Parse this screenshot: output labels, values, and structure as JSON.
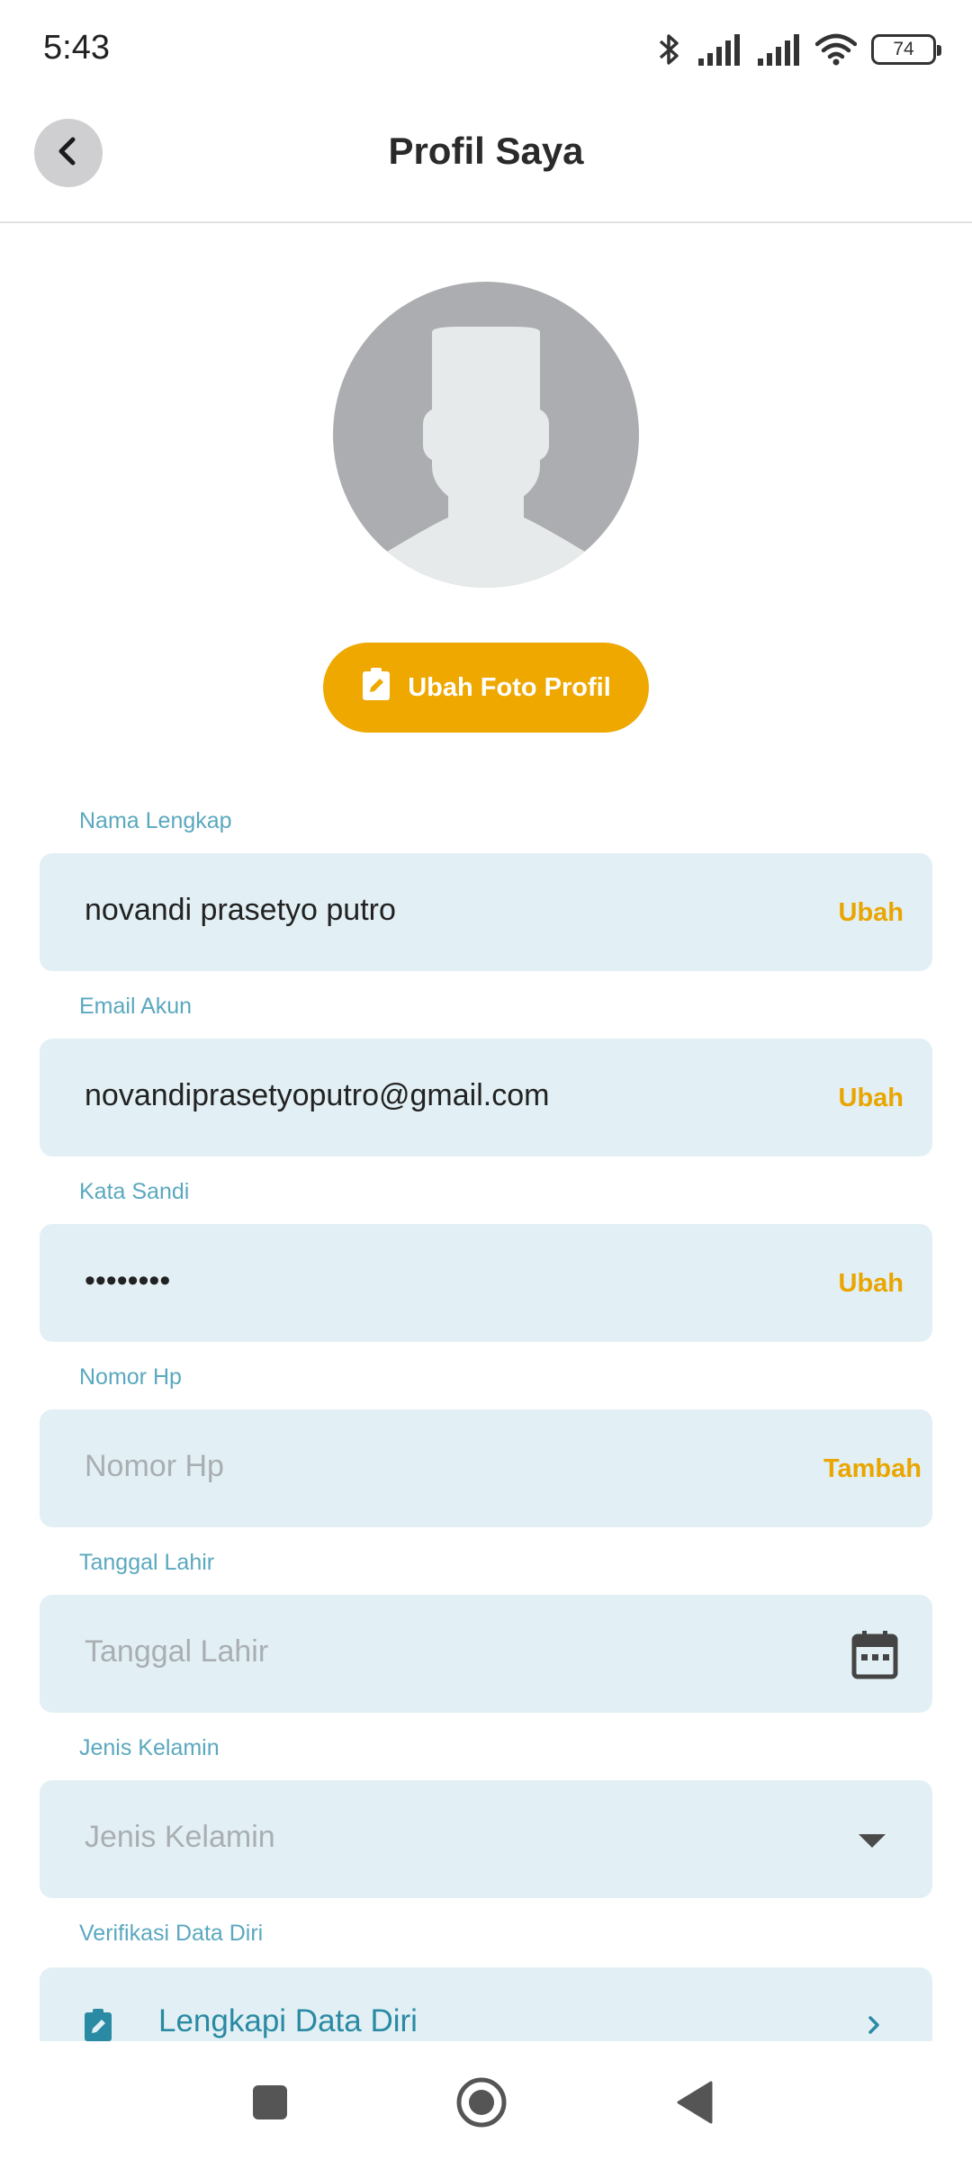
{
  "status_bar": {
    "time": "5:43",
    "battery_level": "74",
    "icons": [
      "bluetooth-icon",
      "signal-icon",
      "signal-icon",
      "wifi-icon",
      "battery-icon"
    ]
  },
  "header": {
    "title": "Profil Saya",
    "back_icon": "chevron-left-icon"
  },
  "profile": {
    "avatar_icon": "default-avatar-icon",
    "change_photo_label": "Ubah Foto Profil",
    "change_photo_icon": "edit-clipboard-icon"
  },
  "fields": {
    "full_name": {
      "label": "Nama Lengkap",
      "value": "novandi prasetyo putro",
      "action": "Ubah"
    },
    "email": {
      "label": "Email Akun",
      "value": "novandiprasetyoputro@gmail.com",
      "action": "Ubah"
    },
    "password": {
      "label": "Kata Sandi",
      "value": "••••••••",
      "action": "Ubah"
    },
    "phone": {
      "label": "Nomor Hp",
      "placeholder": "Nomor Hp",
      "action": "Tambah"
    },
    "birth_date": {
      "label": "Tanggal Lahir",
      "placeholder": "Tanggal Lahir",
      "icon": "calendar-icon"
    },
    "gender": {
      "label": "Jenis Kelamin",
      "placeholder": "Jenis Kelamin",
      "icon": "dropdown-arrow-icon"
    },
    "verification": {
      "label": "Verifikasi Data Diri",
      "link_text": "Lengkapi Data Diri",
      "icon": "edit-clipboard-icon",
      "chevron": "chevron-right-icon"
    }
  },
  "nav_bar": {
    "buttons": [
      "recents-square-icon",
      "home-circle-icon",
      "back-triangle-icon"
    ]
  },
  "colors": {
    "accent": "#eea800",
    "label": "#5aa8bf",
    "field_bg": "#e2f0f5",
    "link": "#2a8aa3"
  }
}
